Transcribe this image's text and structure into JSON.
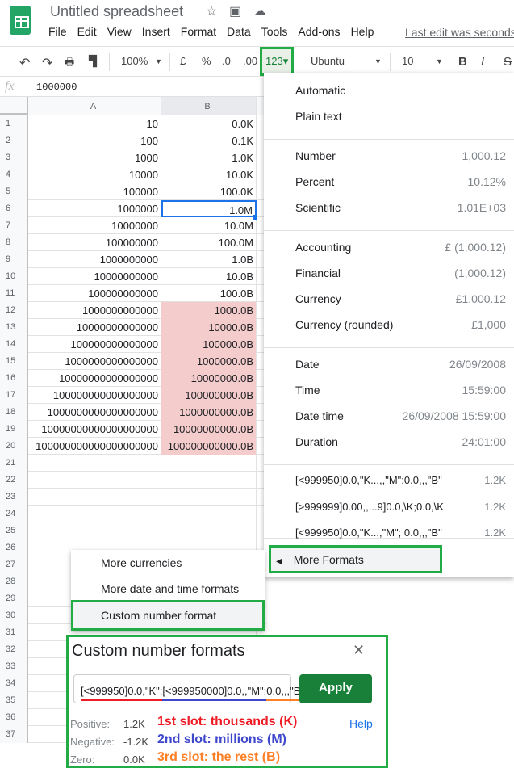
{
  "app": {
    "title": "Untitled spreadsheet",
    "last_edit": "Last edit was seconds"
  },
  "menubar": [
    "File",
    "Edit",
    "View",
    "Insert",
    "Format",
    "Data",
    "Tools",
    "Add-ons",
    "Help"
  ],
  "toolbar": {
    "zoom": "100%",
    "currency": "£",
    "percent": "%",
    "dec_less": ".0",
    "dec_more": ".00",
    "format_btn": "123▾",
    "font": "Ubuntu",
    "size": "10",
    "bold": "B",
    "italic": "I",
    "strike": "S"
  },
  "formula_bar": {
    "fx": "fx",
    "value": "1000000"
  },
  "grid": {
    "columns": [
      "A",
      "B"
    ],
    "colA": [
      "10",
      "100",
      "1000",
      "10000",
      "100000",
      "1000000",
      "10000000",
      "100000000",
      "1000000000",
      "10000000000",
      "100000000000",
      "1000000000000",
      "10000000000000",
      "100000000000000",
      "1000000000000000",
      "10000000000000000",
      "100000000000000000",
      "1000000000000000000",
      "10000000000000000000",
      "100000000000000000000"
    ],
    "colB": [
      "0.0K",
      "0.1K",
      "1.0K",
      "10.0K",
      "100.0K",
      "1.0M",
      "10.0M",
      "100.0M",
      "1.0B",
      "10.0B",
      "100.0B",
      "1000.0B",
      "10000.0B",
      "100000.0B",
      "1000000.0B",
      "10000000.0B",
      "100000000.0B",
      "1000000000.0B",
      "10000000000.0B",
      "100000000000.0B"
    ],
    "row_count": 37,
    "selected_cell": "B6",
    "highlight_color": "#f4cccc"
  },
  "format_menu": {
    "items": [
      {
        "label": "Automatic",
        "value": ""
      },
      {
        "label": "Plain text",
        "value": ""
      },
      {
        "label": "Number",
        "value": "1,000.12"
      },
      {
        "label": "Percent",
        "value": "10.12%"
      },
      {
        "label": "Scientific",
        "value": "1.01E+03"
      },
      {
        "label": "Accounting",
        "value": "£ (1,000.12)"
      },
      {
        "label": "Financial",
        "value": "(1,000.12)"
      },
      {
        "label": "Currency",
        "value": "£1,000.12"
      },
      {
        "label": "Currency (rounded)",
        "value": "£1,000"
      },
      {
        "label": "Date",
        "value": "26/09/2008"
      },
      {
        "label": "Time",
        "value": "15:59:00"
      },
      {
        "label": "Date time",
        "value": "26/09/2008 15:59:00"
      },
      {
        "label": "Duration",
        "value": "24:01:00"
      },
      {
        "label": "[<999950]0.0,\"K...,,\"M\";0.0,,,\"B\"",
        "value": "1.2K"
      },
      {
        "label": "[>999999]0.00,,...9]0.0,\\K;0.0,\\K",
        "value": "1.2K"
      },
      {
        "label": "[<999950]0.0,\"K...,\"M\"; 0.0,,,\"B\"",
        "value": "1.2K"
      }
    ],
    "more_formats": "More Formats"
  },
  "submenu": [
    "More currencies",
    "More date and time formats",
    "Custom number format"
  ],
  "dialog": {
    "title": "Custom number formats",
    "input_parts": [
      "[<999950]0.0,\"K\";",
      "[<999950000]0.0,,\"M\";",
      "0.0,,,\"B\""
    ],
    "apply": "Apply",
    "help": "Help",
    "preview": [
      {
        "label": "Positive:",
        "value": "1.2K"
      },
      {
        "label": "Negative:",
        "value": "-1.2K"
      },
      {
        "label": "Zero:",
        "value": "0.0K"
      }
    ],
    "notes": [
      {
        "text": "1st slot: thousands (K)",
        "color": "#ee1c25"
      },
      {
        "text": "2nd slot: millions (M)",
        "color": "#3f48cc"
      },
      {
        "text": "3rd slot: the rest (B)",
        "color": "#ff7f27"
      }
    ]
  }
}
